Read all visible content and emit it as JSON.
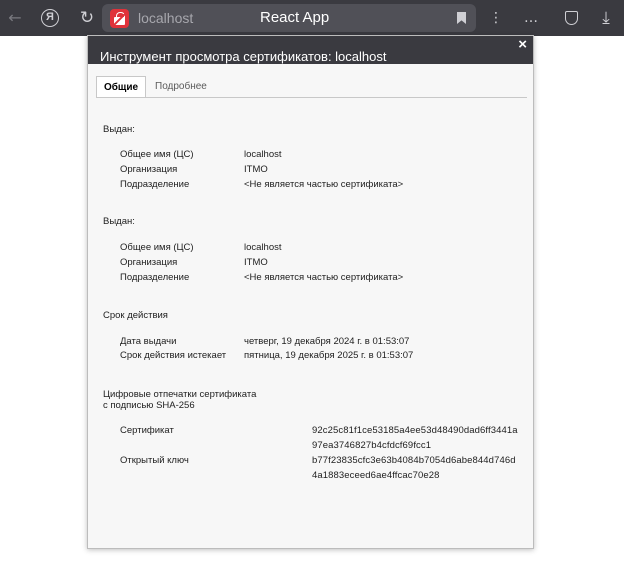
{
  "browser": {
    "address_host": "localhost",
    "tab_title": "React App",
    "accent_color": "#e0323a"
  },
  "dialog": {
    "title": "Инструмент просмотра сертификатов: localhost",
    "tabs": [
      {
        "label": "Общие",
        "active": true
      },
      {
        "label": "Подробнее",
        "active": false
      }
    ],
    "issued_to": {
      "heading": "Выдан:",
      "common_name_label": "Общее имя (ЦС)",
      "common_name": "localhost",
      "organization_label": "Организация",
      "organization": "ITMO",
      "unit_label": "Подразделение",
      "unit": "<Не является частью сертификата>"
    },
    "issued_by": {
      "heading": "Выдан:",
      "common_name_label": "Общее имя (ЦС)",
      "common_name": "localhost",
      "organization_label": "Организация",
      "organization": "ITMO",
      "unit_label": "Подразделение",
      "unit": "<Не является частью сертификата>"
    },
    "validity": {
      "heading": "Срок действия",
      "issued_label": "Дата выдачи",
      "issued": "четверг, 19 декабря 2024 г. в 01:53:07",
      "expires_label": "Срок действия истекает",
      "expires": "пятница, 19 декабря 2025 г. в 01:53:07"
    },
    "fingerprints": {
      "heading_line1": "Цифровые отпечатки сертификата",
      "heading_line2": "с подписью SHA-256",
      "cert_label": "Сертификат",
      "cert_line1": "92c25c81f1ce53185a4ee53d48490dad6ff3441a",
      "cert_line2": "97ea3746827b4cfdcf69fcc1",
      "key_label": "Открытый ключ",
      "key_line1": "b77f23835cfc3e63b4084b7054d6abe844d746d",
      "key_line2": "4a1883eceed6ae4ffcac70e28"
    }
  }
}
